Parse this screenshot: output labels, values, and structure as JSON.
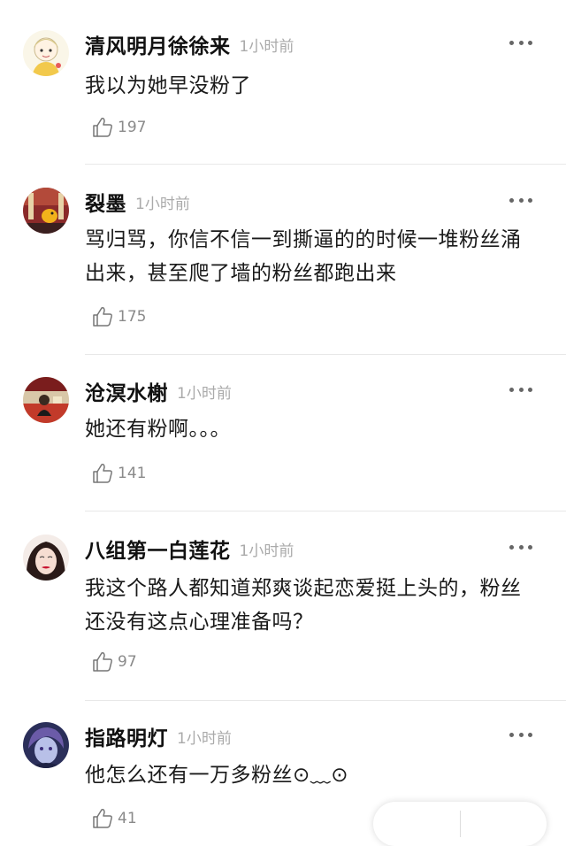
{
  "comments": [
    {
      "user": "清风明月徐徐来",
      "time": "1小时前",
      "text": "我以为她早没粉了",
      "likes": "197",
      "avatar": "cartoon-girl-avatar"
    },
    {
      "user": "裂墨",
      "time": "1小时前",
      "text": "骂归骂，你信不信一到撕逼的的时候一堆粉丝涌出来，甚至爬了墙的粉丝都跑出来",
      "likes": "175",
      "avatar": "red-room-avatar"
    },
    {
      "user": "沧溟水榭",
      "time": "1小时前",
      "text": "她还有粉啊。。。",
      "likes": "141",
      "avatar": "stage-photo-avatar"
    },
    {
      "user": "八组第一白莲花",
      "time": "1小时前",
      "text": "我这个路人都知道郑爽谈起恋爱挺上头的，粉丝还没有这点心理准备吗？",
      "likes": "97",
      "avatar": "woman-red-lips-avatar"
    },
    {
      "user": "指路明灯",
      "time": "1小时前",
      "text": "他怎么还有一万多粉丝⊙﹏⊙",
      "likes": "41",
      "avatar": "anime-boy-avatar"
    }
  ],
  "bottom_bar": {
    "left": "",
    "right": ""
  }
}
